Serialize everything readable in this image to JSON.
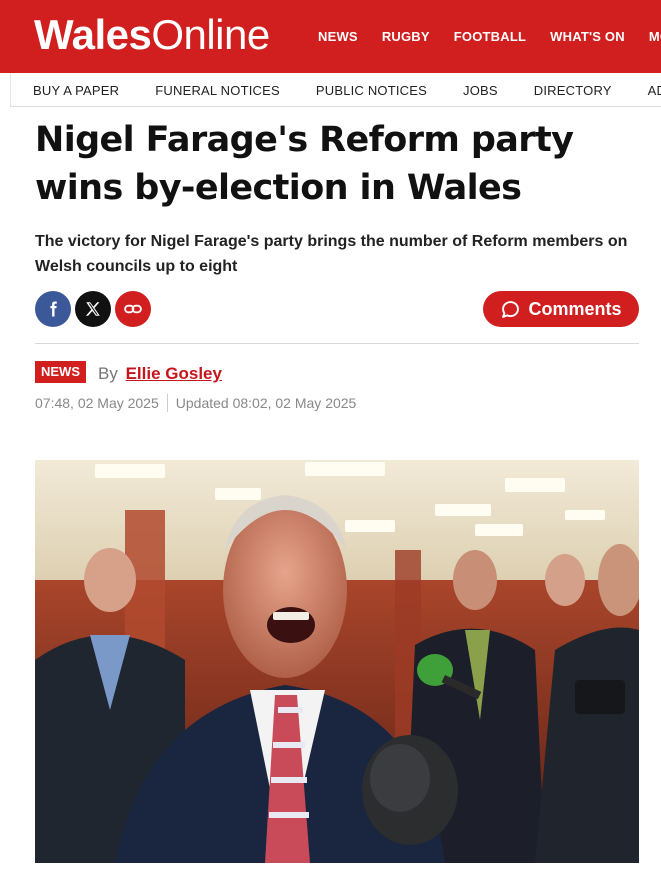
{
  "header": {
    "logo_bold": "Wales",
    "logo_regular": "Online",
    "nav": [
      "NEWS",
      "RUGBY",
      "FOOTBALL",
      "WHAT'S ON",
      "MOI"
    ]
  },
  "subnav": [
    "BUY A PAPER",
    "FUNERAL NOTICES",
    "PUBLIC NOTICES",
    "JOBS",
    "DIRECTORY",
    "ADVER"
  ],
  "article": {
    "headline": "Nigel Farage's Reform party wins by-election in Wales",
    "standfirst": "The victory for Nigel Farage's party brings the number of Reform members on Welsh councils up to eight",
    "comments_label": "Comments",
    "section_tag": "NEWS",
    "by_prefix": "By",
    "author": "Ellie Gosley",
    "published": "07:48, 02 May 2025",
    "updated": "Updated 08:02, 02 May 2025"
  },
  "share": {
    "icons": [
      "facebook-icon",
      "x-icon",
      "link-icon"
    ]
  },
  "colors": {
    "brand_red": "#d11e1e",
    "facebook_blue": "#3b5998"
  }
}
